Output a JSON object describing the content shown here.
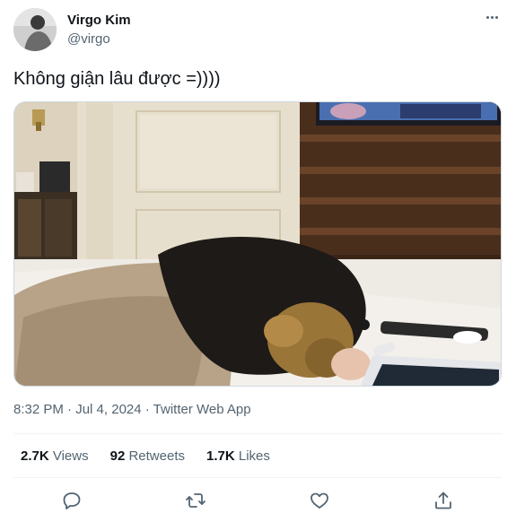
{
  "author": {
    "name": "Virgo Kim",
    "handle": "@virgo"
  },
  "tweet": {
    "text": "Không giận lâu được =))))",
    "media_alt": "Photo"
  },
  "meta": {
    "time": "8:32 PM",
    "separator1": " · ",
    "date": "Jul 4, 2024",
    "separator2": " · ",
    "source": "Twitter Web App"
  },
  "stats": [
    {
      "count": "2.7K",
      "label": "Views"
    },
    {
      "count": "92",
      "label": "Retweets"
    },
    {
      "count": "1.7K",
      "label": "Likes"
    }
  ],
  "icons": {
    "more": "more-horizontal-icon",
    "reply": "reply-icon",
    "retweet": "retweet-icon",
    "like": "heart-icon",
    "share": "share-icon"
  },
  "colors": {
    "text": "#0f1419",
    "secondary": "#536471",
    "border": "#eff3f4"
  }
}
